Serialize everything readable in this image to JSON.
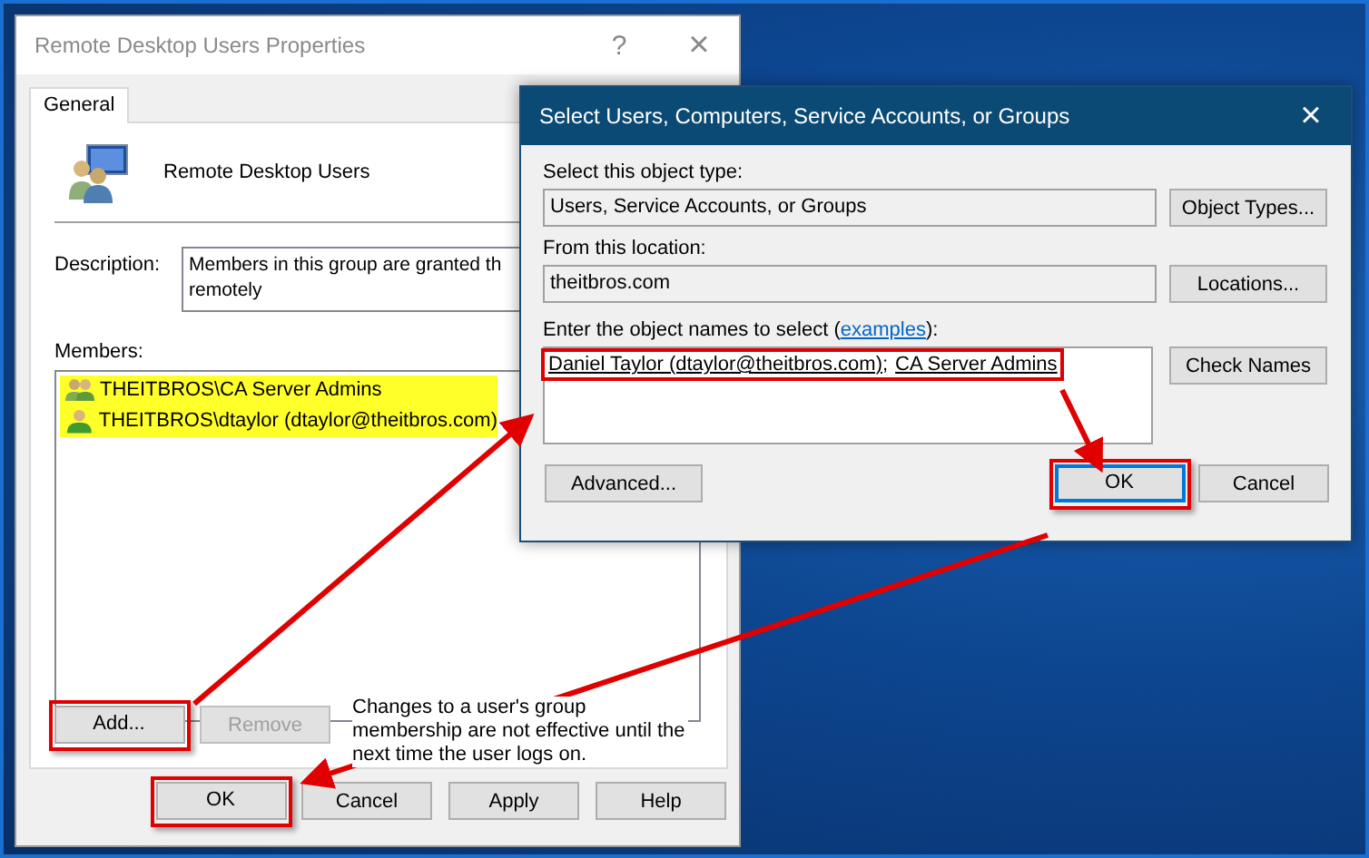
{
  "properties_window": {
    "title": "Remote Desktop Users Properties",
    "help_glyph": "?",
    "close_glyph": "×",
    "tabs": [
      {
        "label": "General",
        "selected": true
      }
    ],
    "group_name": "Remote Desktop Users",
    "description": {
      "label": "Description:",
      "lines": [
        "Members in this group are granted th",
        "remotely"
      ]
    },
    "members": {
      "label": "Members:",
      "items": [
        {
          "kind": "group",
          "text": "THEITBROS\\CA Server Admins",
          "highlighted": true
        },
        {
          "kind": "user",
          "text": "THEITBROS\\dtaylor (dtaylor@theitbros.com)",
          "highlighted": true
        }
      ]
    },
    "member_buttons": [
      {
        "label": "Add...",
        "disabled": false
      },
      {
        "label": "Remove",
        "disabled": true
      }
    ],
    "note": "Changes to a user's group membership are not effective until the next time the user logs on.",
    "buttons": [
      {
        "label": "OK"
      },
      {
        "label": "Cancel"
      },
      {
        "label": "Apply"
      },
      {
        "label": "Help"
      }
    ]
  },
  "select_dialog": {
    "title": "Select Users, Computers, Service Accounts, or Groups",
    "close_glyph": "×",
    "object_type": {
      "label": "Select this object type:",
      "value": "Users, Service Accounts, or Groups",
      "button": "Object Types..."
    },
    "location": {
      "label": "From this location:",
      "value": "theitbros.com",
      "button": "Locations..."
    },
    "names": {
      "label": "Enter the object names to select (",
      "link": "examples",
      "label_end": "):",
      "entries": [
        "Daniel Taylor (dtaylor@theitbros.com)",
        "CA Server Admins"
      ],
      "separator": ";",
      "button": "Check Names"
    },
    "buttons": [
      {
        "label": "Advanced...",
        "focused": false
      },
      {
        "label": "OK",
        "focused": true
      },
      {
        "label": "Cancel",
        "focused": false
      }
    ]
  }
}
